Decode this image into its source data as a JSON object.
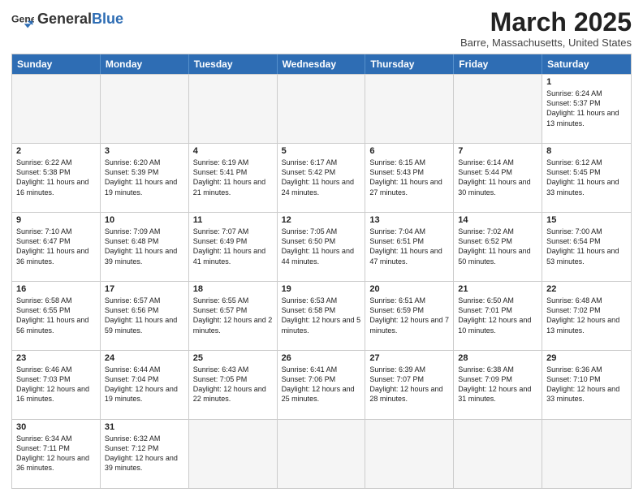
{
  "header": {
    "logo_general": "General",
    "logo_blue": "Blue",
    "month_title": "March 2025",
    "location": "Barre, Massachusetts, United States"
  },
  "weekdays": [
    "Sunday",
    "Monday",
    "Tuesday",
    "Wednesday",
    "Thursday",
    "Friday",
    "Saturday"
  ],
  "rows": [
    [
      {
        "day": "",
        "info": "",
        "empty": true
      },
      {
        "day": "",
        "info": "",
        "empty": true
      },
      {
        "day": "",
        "info": "",
        "empty": true
      },
      {
        "day": "",
        "info": "",
        "empty": true
      },
      {
        "day": "",
        "info": "",
        "empty": true
      },
      {
        "day": "",
        "info": "",
        "empty": true
      },
      {
        "day": "1",
        "info": "Sunrise: 6:24 AM\nSunset: 5:37 PM\nDaylight: 11 hours and 13 minutes.",
        "empty": false
      }
    ],
    [
      {
        "day": "2",
        "info": "Sunrise: 6:22 AM\nSunset: 5:38 PM\nDaylight: 11 hours and 16 minutes.",
        "empty": false
      },
      {
        "day": "3",
        "info": "Sunrise: 6:20 AM\nSunset: 5:39 PM\nDaylight: 11 hours and 19 minutes.",
        "empty": false
      },
      {
        "day": "4",
        "info": "Sunrise: 6:19 AM\nSunset: 5:41 PM\nDaylight: 11 hours and 21 minutes.",
        "empty": false
      },
      {
        "day": "5",
        "info": "Sunrise: 6:17 AM\nSunset: 5:42 PM\nDaylight: 11 hours and 24 minutes.",
        "empty": false
      },
      {
        "day": "6",
        "info": "Sunrise: 6:15 AM\nSunset: 5:43 PM\nDaylight: 11 hours and 27 minutes.",
        "empty": false
      },
      {
        "day": "7",
        "info": "Sunrise: 6:14 AM\nSunset: 5:44 PM\nDaylight: 11 hours and 30 minutes.",
        "empty": false
      },
      {
        "day": "8",
        "info": "Sunrise: 6:12 AM\nSunset: 5:45 PM\nDaylight: 11 hours and 33 minutes.",
        "empty": false
      }
    ],
    [
      {
        "day": "9",
        "info": "Sunrise: 7:10 AM\nSunset: 6:47 PM\nDaylight: 11 hours and 36 minutes.",
        "empty": false
      },
      {
        "day": "10",
        "info": "Sunrise: 7:09 AM\nSunset: 6:48 PM\nDaylight: 11 hours and 39 minutes.",
        "empty": false
      },
      {
        "day": "11",
        "info": "Sunrise: 7:07 AM\nSunset: 6:49 PM\nDaylight: 11 hours and 41 minutes.",
        "empty": false
      },
      {
        "day": "12",
        "info": "Sunrise: 7:05 AM\nSunset: 6:50 PM\nDaylight: 11 hours and 44 minutes.",
        "empty": false
      },
      {
        "day": "13",
        "info": "Sunrise: 7:04 AM\nSunset: 6:51 PM\nDaylight: 11 hours and 47 minutes.",
        "empty": false
      },
      {
        "day": "14",
        "info": "Sunrise: 7:02 AM\nSunset: 6:52 PM\nDaylight: 11 hours and 50 minutes.",
        "empty": false
      },
      {
        "day": "15",
        "info": "Sunrise: 7:00 AM\nSunset: 6:54 PM\nDaylight: 11 hours and 53 minutes.",
        "empty": false
      }
    ],
    [
      {
        "day": "16",
        "info": "Sunrise: 6:58 AM\nSunset: 6:55 PM\nDaylight: 11 hours and 56 minutes.",
        "empty": false
      },
      {
        "day": "17",
        "info": "Sunrise: 6:57 AM\nSunset: 6:56 PM\nDaylight: 11 hours and 59 minutes.",
        "empty": false
      },
      {
        "day": "18",
        "info": "Sunrise: 6:55 AM\nSunset: 6:57 PM\nDaylight: 12 hours and 2 minutes.",
        "empty": false
      },
      {
        "day": "19",
        "info": "Sunrise: 6:53 AM\nSunset: 6:58 PM\nDaylight: 12 hours and 5 minutes.",
        "empty": false
      },
      {
        "day": "20",
        "info": "Sunrise: 6:51 AM\nSunset: 6:59 PM\nDaylight: 12 hours and 7 minutes.",
        "empty": false
      },
      {
        "day": "21",
        "info": "Sunrise: 6:50 AM\nSunset: 7:01 PM\nDaylight: 12 hours and 10 minutes.",
        "empty": false
      },
      {
        "day": "22",
        "info": "Sunrise: 6:48 AM\nSunset: 7:02 PM\nDaylight: 12 hours and 13 minutes.",
        "empty": false
      }
    ],
    [
      {
        "day": "23",
        "info": "Sunrise: 6:46 AM\nSunset: 7:03 PM\nDaylight: 12 hours and 16 minutes.",
        "empty": false
      },
      {
        "day": "24",
        "info": "Sunrise: 6:44 AM\nSunset: 7:04 PM\nDaylight: 12 hours and 19 minutes.",
        "empty": false
      },
      {
        "day": "25",
        "info": "Sunrise: 6:43 AM\nSunset: 7:05 PM\nDaylight: 12 hours and 22 minutes.",
        "empty": false
      },
      {
        "day": "26",
        "info": "Sunrise: 6:41 AM\nSunset: 7:06 PM\nDaylight: 12 hours and 25 minutes.",
        "empty": false
      },
      {
        "day": "27",
        "info": "Sunrise: 6:39 AM\nSunset: 7:07 PM\nDaylight: 12 hours and 28 minutes.",
        "empty": false
      },
      {
        "day": "28",
        "info": "Sunrise: 6:38 AM\nSunset: 7:09 PM\nDaylight: 12 hours and 31 minutes.",
        "empty": false
      },
      {
        "day": "29",
        "info": "Sunrise: 6:36 AM\nSunset: 7:10 PM\nDaylight: 12 hours and 33 minutes.",
        "empty": false
      }
    ],
    [
      {
        "day": "30",
        "info": "Sunrise: 6:34 AM\nSunset: 7:11 PM\nDaylight: 12 hours and 36 minutes.",
        "empty": false
      },
      {
        "day": "31",
        "info": "Sunrise: 6:32 AM\nSunset: 7:12 PM\nDaylight: 12 hours and 39 minutes.",
        "empty": false
      },
      {
        "day": "",
        "info": "",
        "empty": true
      },
      {
        "day": "",
        "info": "",
        "empty": true
      },
      {
        "day": "",
        "info": "",
        "empty": true
      },
      {
        "day": "",
        "info": "",
        "empty": true
      },
      {
        "day": "",
        "info": "",
        "empty": true
      }
    ]
  ]
}
